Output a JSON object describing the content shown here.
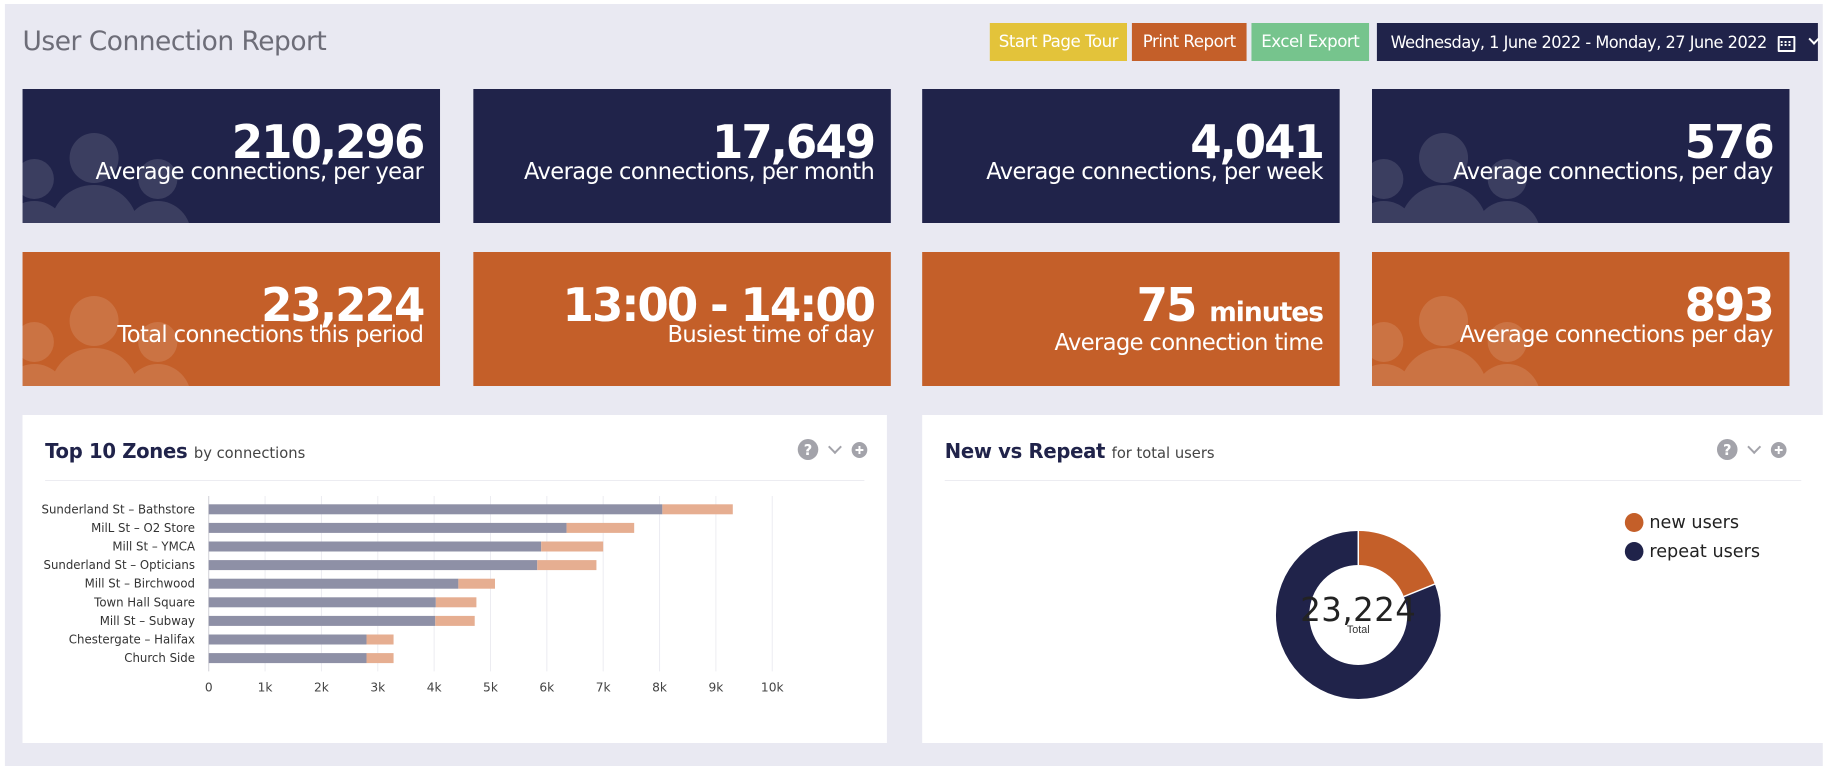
{
  "page": {
    "title": "User Connection Report"
  },
  "toolbar": {
    "tour_label": "Start Page Tour",
    "print_label": "Print Report",
    "excel_label": "Excel Export",
    "date_range": "Wednesday, 1 June 2022 - Monday, 27 June 2022"
  },
  "stats_top": [
    {
      "value": "210,296",
      "label": "Average connections, per year"
    },
    {
      "value": "17,649",
      "label": "Average connections, per month"
    },
    {
      "value": "4,041",
      "label": "Average connections, per week"
    },
    {
      "value": "576",
      "label": "Average connections, per day"
    }
  ],
  "stats_bottom": [
    {
      "value": "23,224",
      "label": "Total connections this period"
    },
    {
      "value": "13:00 - 14:00",
      "label": "Busiest time of day"
    },
    {
      "value": "75",
      "unit": "minutes",
      "label": "Average connection time"
    },
    {
      "value": "893",
      "label": "Average connections per day"
    }
  ],
  "zones_panel": {
    "title": "Top 10 Zones",
    "subtitle": "by connections",
    "help": "?"
  },
  "nvr_panel": {
    "title": "New vs Repeat",
    "subtitle": "for total users",
    "help": "?"
  },
  "colors": {
    "navy": "#20234a",
    "orange": "#c45f29",
    "yellow": "#e3c33a",
    "green": "#76c48d",
    "bar_a": "#8e90a6",
    "bar_b": "#e6ae91"
  },
  "chart_data": [
    {
      "type": "bar",
      "orientation": "horizontal",
      "stacked": true,
      "categories": [
        "Sunderland St – Bathstore",
        "MilL St – O2 Store",
        "Mill St – YMCA",
        "Sunderland St – Opticians",
        "Mill St – Birchwood",
        "Town Hall Square",
        "Mill St – Subway",
        "Chestergate – Halifax",
        "Church Side"
      ],
      "series": [
        {
          "values": [
            8050,
            6350,
            5900,
            5830,
            4430,
            4030,
            4020,
            2800,
            2800
          ]
        },
        {
          "values": [
            1250,
            1200,
            1100,
            1050,
            650,
            720,
            700,
            480,
            480
          ]
        }
      ],
      "xlim": [
        0,
        10000
      ],
      "xticks": [
        "0",
        "1k",
        "2k",
        "3k",
        "4k",
        "5k",
        "6k",
        "7k",
        "8k",
        "9k",
        "10k"
      ],
      "grid": true
    },
    {
      "type": "pie",
      "donut": true,
      "center_value": "23,224",
      "center_label": "Total",
      "slices": [
        {
          "name": "new users",
          "value": 0.19,
          "color": "#c45f29"
        },
        {
          "name": "repeat users",
          "value": 0.81,
          "color": "#20234a"
        }
      ],
      "legend": "top-right"
    }
  ]
}
